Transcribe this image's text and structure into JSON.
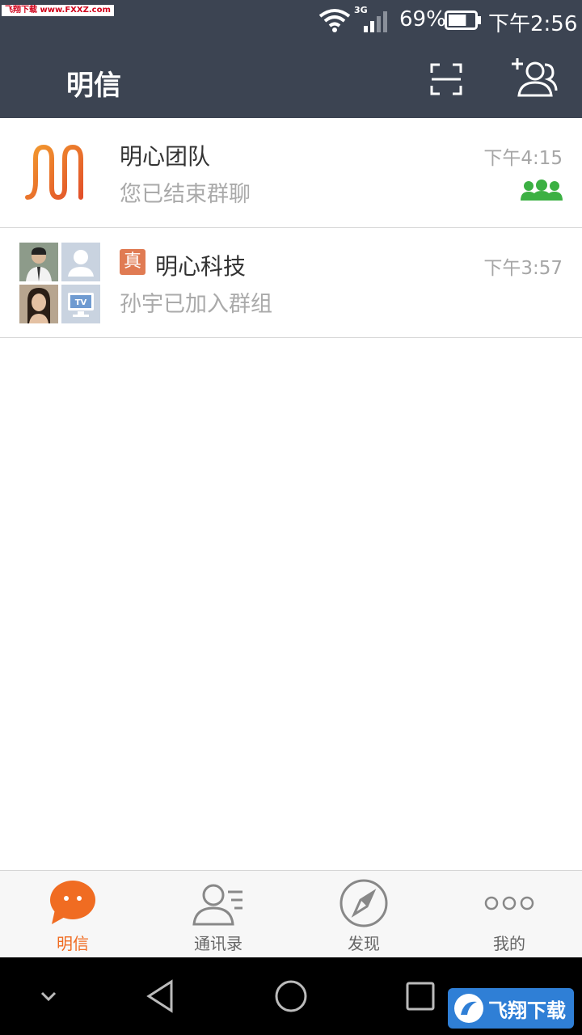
{
  "status_bar": {
    "watermark": "飞翔下载 www.FXXZ.com",
    "network": "3G",
    "battery_percent": "69%",
    "battery_level": 0.69,
    "time": "下午2:56"
  },
  "header": {
    "title": "明信",
    "scan_icon": "scan-icon",
    "add_contact_icon": "add-contact-icon"
  },
  "conversations": [
    {
      "name": "明心团队",
      "preview": "您已结束群聊",
      "time": "下午4:15",
      "avatar_icon": "mingxin-logo-icon",
      "status_icon": "group-icon",
      "status_color": "#3cb043"
    },
    {
      "badge": "真",
      "name": "明心科技",
      "preview": "孙宇已加入群组",
      "time": "下午3:57",
      "avatar_icon": "group-avatar-icon"
    }
  ],
  "bottom_nav": [
    {
      "label": "明信",
      "icon": "chat-bubble-icon",
      "active": true
    },
    {
      "label": "通讯录",
      "icon": "contacts-icon",
      "active": false
    },
    {
      "label": "发现",
      "icon": "compass-icon",
      "active": false
    },
    {
      "label": "我的",
      "icon": "more-dots-icon",
      "active": false
    }
  ],
  "system_nav": {
    "icons": [
      "collapse-icon",
      "back-icon",
      "home-icon",
      "recents-icon"
    ]
  },
  "watermark_bottom": "飞翔下载",
  "colors": {
    "header_bg": "#3c4452",
    "accent": "#f06c22",
    "badge": "#e07b53",
    "group_icon": "#3cb043"
  }
}
